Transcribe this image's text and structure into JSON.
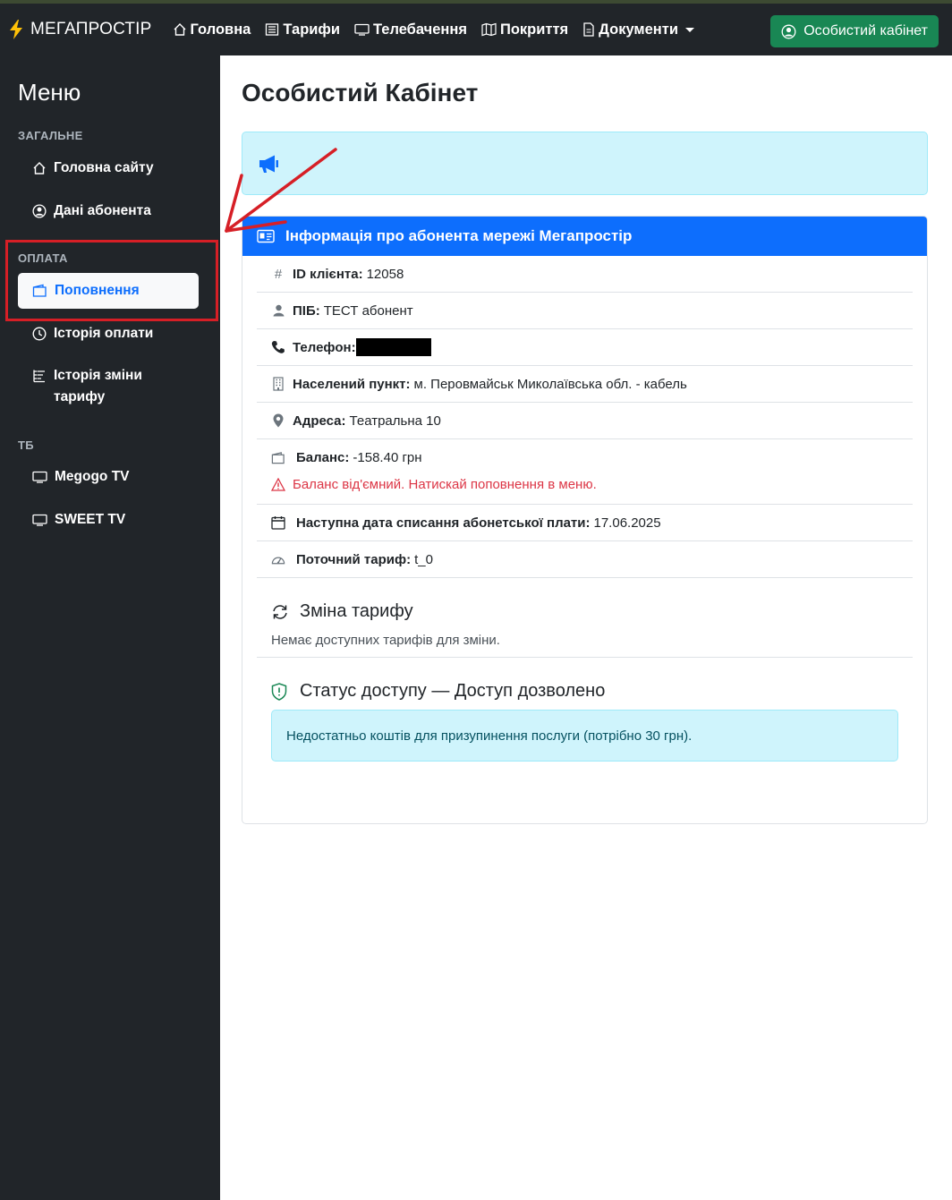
{
  "navbar": {
    "brand": "МЕГАПРОСТІР",
    "links": [
      {
        "label": "Головна",
        "icon": "house-icon"
      },
      {
        "label": "Тарифи",
        "icon": "tariff-list-icon"
      },
      {
        "label": "Телебачення",
        "icon": "tv-icon"
      },
      {
        "label": "Покриття",
        "icon": "map-icon"
      },
      {
        "label": "Документи",
        "icon": "document-icon"
      }
    ],
    "cabinet_button": "Особистий кабінет"
  },
  "sidebar": {
    "title": "Меню",
    "sections": [
      {
        "label": "ЗАГАЛЬНЕ",
        "items": [
          {
            "label": "Головна сайту",
            "icon": "house-icon"
          },
          {
            "label": "Дані абонента",
            "icon": "user-circle-icon"
          }
        ]
      },
      {
        "label": "ОПЛАТА",
        "items": [
          {
            "label": "Поповнення",
            "icon": "wallet-icon",
            "active": true
          },
          {
            "label": "Історія оплати",
            "icon": "clock-icon"
          },
          {
            "label": "Історія зміни тарифу",
            "icon": "list-ordered-icon"
          }
        ]
      },
      {
        "label": "ТБ",
        "items": [
          {
            "label": "Megogo TV",
            "icon": "tv-icon"
          },
          {
            "label": "SWEET TV",
            "icon": "tv-icon"
          }
        ]
      }
    ]
  },
  "main": {
    "title": "Особистий Кабінет",
    "card_header": "Інформація про абонента мережі Мегапростір",
    "info": {
      "id_label": "ID клієнта:",
      "id_value": "12058",
      "name_label": "ПІБ:",
      "name_value": "ТЕСТ абонент",
      "phone_label": "Телефон:",
      "city_label": "Населений пункт:",
      "city_value": "м. Перовмайськ Миколаївська обл. - кабель",
      "address_label": "Адреса:",
      "address_value": "Театральна 10",
      "balance_label": "Баланс:",
      "balance_value": "-158.40 грн",
      "balance_warning": "Баланс від'ємний. Натискай поповнення в меню.",
      "next_date_label": "Наступна дата списання абонетської плати:",
      "next_date_value": "17.06.2025",
      "tariff_label": "Поточний тариф:",
      "tariff_value": "t_0"
    },
    "tariff_change": {
      "title": "Зміна тарифу",
      "text": "Немає доступних тарифів для зміни."
    },
    "access_status": {
      "title": "Статус доступу — Доступ дозволено",
      "message": "Недостатньо коштів для призупинення послуги (потрібно 30 грн)."
    }
  },
  "colors": {
    "navbar_bg": "#212529",
    "primary": "#0d6efd",
    "success": "#198754",
    "info_bg": "#cff4fc",
    "danger": "#dc3545",
    "annotation_red": "#d61f26"
  }
}
